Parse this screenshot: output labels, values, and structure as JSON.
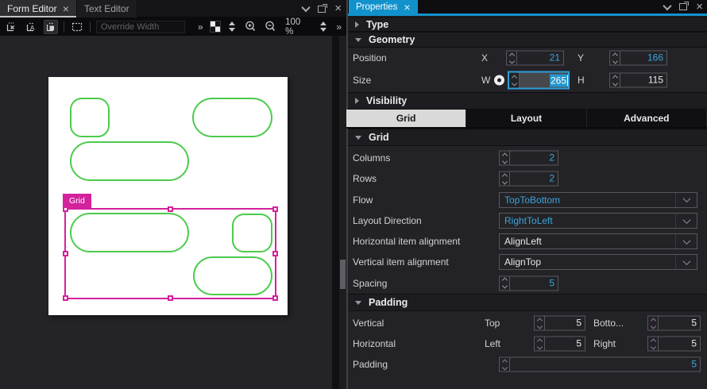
{
  "icons": {
    "close": "×",
    "letter_a": "A"
  },
  "left_panel": {
    "tab_form_editor": "Form Editor",
    "tab_text_editor": "Text Editor",
    "toolbar": {
      "override_width_placeholder": "Override Width",
      "overflow_left": "»",
      "overflow_right": "»",
      "zoom_level": "100 %"
    },
    "canvas": {
      "selection_label": "Grid"
    }
  },
  "right_panel": {
    "tab_properties": "Properties",
    "type_section": {
      "label": "Type"
    },
    "geometry_section": {
      "label": "Geometry",
      "position_label": "Position",
      "x_label": "X",
      "x_value": "21",
      "y_label": "Y",
      "y_value": "166",
      "size_label": "Size",
      "w_label": "W",
      "w_value": "265",
      "h_label": "H",
      "h_value": "115"
    },
    "visibility_section": {
      "label": "Visibility"
    },
    "category_tabs": {
      "grid": "Grid",
      "layout": "Layout",
      "advanced": "Advanced"
    },
    "grid_section": {
      "label": "Grid",
      "columns_label": "Columns",
      "columns_value": "2",
      "rows_label": "Rows",
      "rows_value": "2",
      "flow_label": "Flow",
      "flow_value": "TopToBottom",
      "layout_direction_label": "Layout Direction",
      "layout_direction_value": "RightToLeft",
      "h_align_label": "Horizontal item alignment",
      "h_align_value": "AlignLeft",
      "v_align_label": "Vertical item alignment",
      "v_align_value": "AlignTop",
      "spacing_label": "Spacing",
      "spacing_value": "5"
    },
    "padding_section": {
      "label": "Padding",
      "vertical_label": "Vertical",
      "top_label": "Top",
      "top_value": "5",
      "bottom_label": "Botto...",
      "bottom_value": "5",
      "horizontal_label": "Horizontal",
      "left_label": "Left",
      "left_value": "5",
      "right_label": "Right",
      "right_value": "5",
      "padding_label": "Padding",
      "padding_value": "5"
    }
  }
}
